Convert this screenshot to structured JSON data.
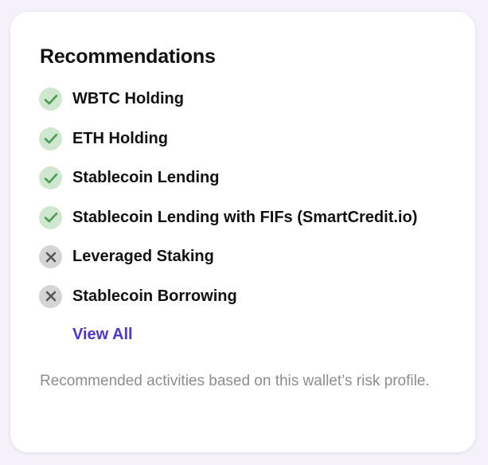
{
  "card": {
    "title": "Recommendations",
    "items": [
      {
        "label": "WBTC Holding",
        "status": "recommended",
        "icon": "check-icon"
      },
      {
        "label": "ETH Holding",
        "status": "recommended",
        "icon": "check-icon"
      },
      {
        "label": "Stablecoin Lending",
        "status": "recommended",
        "icon": "check-icon"
      },
      {
        "label": "Stablecoin Lending with FIFs (SmartCredit.io)",
        "status": "recommended",
        "icon": "check-icon"
      },
      {
        "label": "Leveraged Staking",
        "status": "not-recommended",
        "icon": "cross-icon"
      },
      {
        "label": "Stablecoin Borrowing",
        "status": "not-recommended",
        "icon": "cross-icon"
      }
    ],
    "view_all_label": "View All",
    "footer_text": "Recommended activities based on this wallet’s risk profile."
  },
  "colors": {
    "page_background": "#f4f1fb",
    "card_background": "#ffffff",
    "check_circle": "#cfe6cf",
    "check_mark": "#4f9a56",
    "cross_circle": "#d4d4d4",
    "cross_mark": "#555555",
    "link": "#4f35d2",
    "muted_text": "#8d8d8d"
  }
}
